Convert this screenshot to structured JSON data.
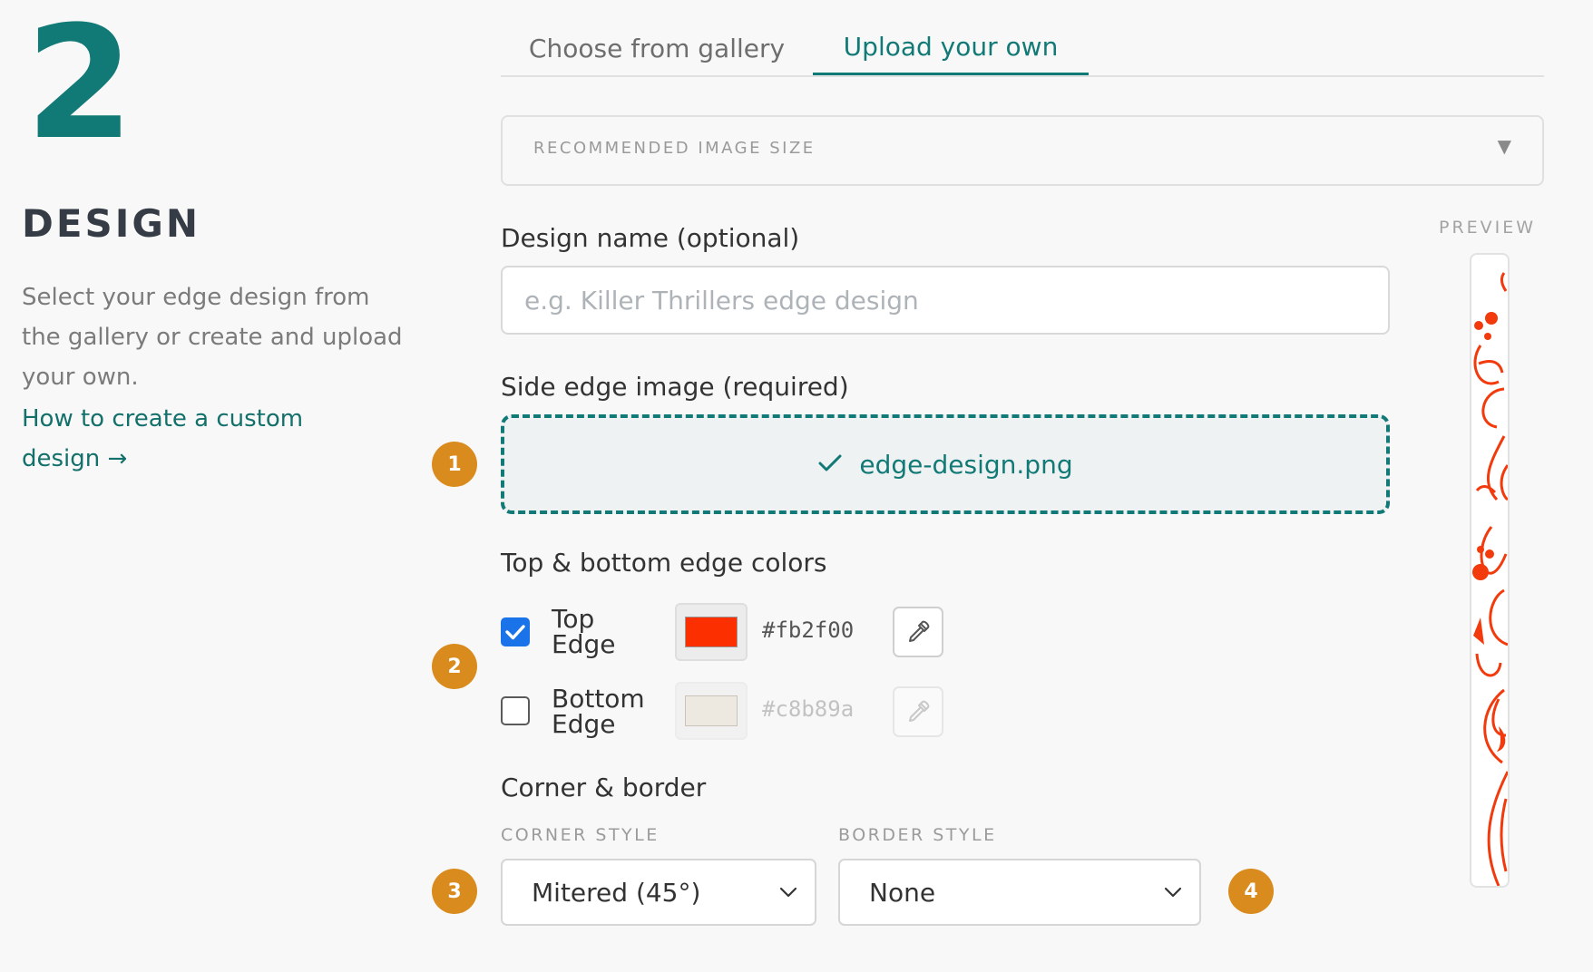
{
  "step": {
    "number": "2",
    "title": "DESIGN",
    "description": "Select your edge design from the gallery or create and upload your own.",
    "help_link": "How to create a custom design →"
  },
  "tabs": [
    {
      "label": "Choose from gallery",
      "active": false
    },
    {
      "label": "Upload your own",
      "active": true
    }
  ],
  "recommended_size": {
    "label": "RECOMMENDED IMAGE SIZE",
    "caret": "▼"
  },
  "preview": {
    "label": "PREVIEW"
  },
  "design_name": {
    "label": "Design name (optional)",
    "value": "",
    "placeholder": "e.g. Killer Thrillers edge design"
  },
  "side_edge": {
    "label": "Side edge image (required)",
    "file_name": "edge-design.png",
    "check_icon": "check-icon"
  },
  "edge_colors": {
    "label": "Top & bottom edge colors",
    "top": {
      "line1": "Top",
      "line2": "Edge",
      "checked": true,
      "hex": "#fb2f00",
      "color": "#fb2f00"
    },
    "bottom": {
      "line1": "Bottom",
      "line2": "Edge",
      "checked": false,
      "hex": "#c8b89a",
      "color": "#ede9e0"
    }
  },
  "corner_border": {
    "label": "Corner & border",
    "corner_style": {
      "label": "CORNER STYLE",
      "selected": "Mitered (45°)"
    },
    "border_style": {
      "label": "BORDER STYLE",
      "selected": "None"
    }
  },
  "badges": [
    "1",
    "2",
    "3",
    "4"
  ],
  "colors": {
    "accent": "#127a76",
    "badge": "#da8b1d",
    "checkbox": "#1a73e8",
    "preview_ornament": "#f23a0c"
  }
}
